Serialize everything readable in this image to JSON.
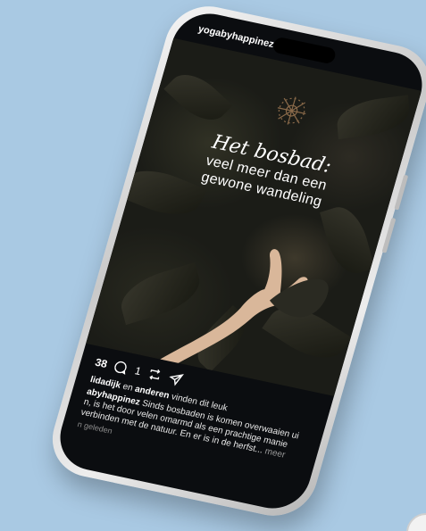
{
  "post": {
    "username": "yogabyhappinez",
    "headline_script": "Het bosbad:",
    "headline_line1": "veel meer dan een",
    "headline_line2": "gewone wandeling",
    "likes_count": "38",
    "comments_count": "1",
    "liked_by_user": "lidadijk",
    "liked_by_joiner": "en",
    "liked_by_others": "anderen",
    "liked_by_suffix": "vinden dit leuk",
    "caption_user": "abyhappinez",
    "caption_text_1": "Sinds bosbaden is komen overwaaien ui",
    "caption_text_2": "n, is het door velen omarmd als een prachtige manie",
    "caption_text_3": "verbinden met de natuur. En er is in de herfst...",
    "caption_more": "meer",
    "timestamp": "n geleden"
  },
  "colors": {
    "background": "#a9c9e3",
    "screen": "#0b0d10",
    "logo_accent": "#8a6a4a"
  },
  "icons": {
    "comment": "comment-icon",
    "repost": "repost-icon",
    "share": "share-icon"
  }
}
